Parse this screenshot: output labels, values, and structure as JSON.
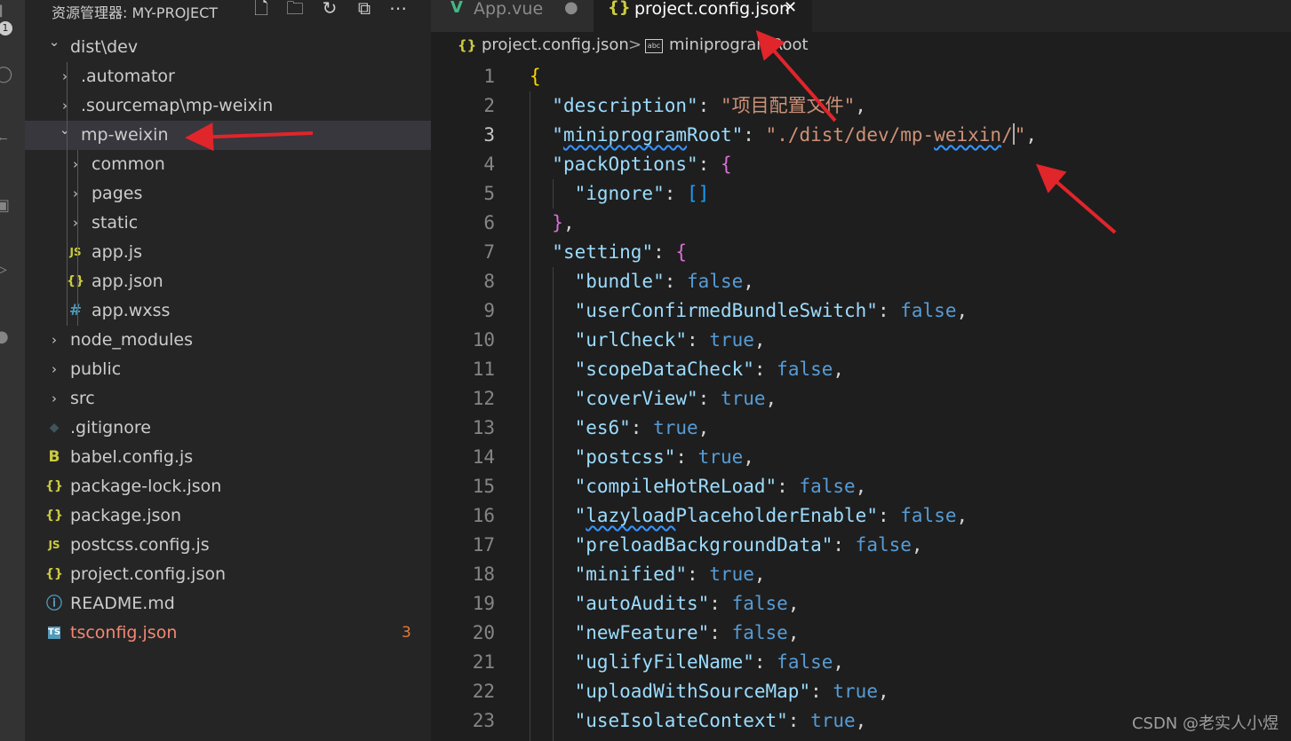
{
  "activity_bar": {
    "scm_badge": "1",
    "icons": [
      "explorer-icon",
      "search-icon",
      "source-control-icon",
      "extensions-icon",
      "run-icon",
      "account-icon"
    ]
  },
  "sidebar": {
    "title": "资源管理器: MY-PROJECT",
    "actions": [
      "new-file-icon",
      "new-folder-icon",
      "refresh-icon",
      "collapse-all-icon",
      "more-icon"
    ],
    "tree": [
      {
        "label": "dist\\dev",
        "type": "folder",
        "expanded": true,
        "depth": 0
      },
      {
        "label": ".automator",
        "type": "folder",
        "expanded": false,
        "depth": 1
      },
      {
        "label": ".sourcemap\\mp-weixin",
        "type": "folder",
        "expanded": false,
        "depth": 1
      },
      {
        "label": "mp-weixin",
        "type": "folder",
        "expanded": true,
        "depth": 1,
        "selected": true
      },
      {
        "label": "common",
        "type": "folder",
        "expanded": false,
        "depth": 2
      },
      {
        "label": "pages",
        "type": "folder",
        "expanded": false,
        "depth": 2
      },
      {
        "label": "static",
        "type": "folder",
        "expanded": false,
        "depth": 2
      },
      {
        "label": "app.js",
        "type": "js",
        "depth": 2
      },
      {
        "label": "app.json",
        "type": "json",
        "depth": 2
      },
      {
        "label": "app.wxss",
        "type": "css",
        "depth": 2
      },
      {
        "label": "node_modules",
        "type": "folder",
        "expanded": false,
        "depth": 0
      },
      {
        "label": "public",
        "type": "folder",
        "expanded": false,
        "depth": 0
      },
      {
        "label": "src",
        "type": "folder",
        "expanded": false,
        "depth": 0
      },
      {
        "label": ".gitignore",
        "type": "git",
        "depth": 0
      },
      {
        "label": "babel.config.js",
        "type": "babel",
        "depth": 0
      },
      {
        "label": "package-lock.json",
        "type": "json",
        "depth": 0
      },
      {
        "label": "package.json",
        "type": "json",
        "depth": 0
      },
      {
        "label": "postcss.config.js",
        "type": "js",
        "depth": 0
      },
      {
        "label": "project.config.json",
        "type": "json",
        "depth": 0
      },
      {
        "label": "README.md",
        "type": "info",
        "depth": 0
      },
      {
        "label": "tsconfig.json",
        "type": "ts",
        "depth": 0,
        "error_count": "3"
      }
    ]
  },
  "tabs": [
    {
      "label": "App.vue",
      "active": false,
      "modified": true
    },
    {
      "label": "project.config.json",
      "active": true,
      "modified": false
    }
  ],
  "breadcrumb": {
    "file": "project.config.json",
    "separator": ">",
    "symbol": "miniprogramRoot"
  },
  "editor": {
    "current_line": 3,
    "lines": [
      {
        "n": "1",
        "html": "<span class=\"y\">{</span>"
      },
      {
        "n": "2",
        "html": "  <span class=\"k\">\"description\"</span><span class=\"p\">: </span><span class=\"s\">\"项目配置文件\"</span><span class=\"p\">,</span>"
      },
      {
        "n": "3",
        "html": "  <span class=\"k\">\"<span class=\"squig\">miniprogram</span>Root\"</span><span class=\"p\">: </span><span class=\"s\">\"./dist/dev/mp-<span class=\"squig\">weixin</span>/<span class=\"cursor\"></span>\"</span><span class=\"p\">,</span>"
      },
      {
        "n": "4",
        "html": "  <span class=\"k\">\"packOptions\"</span><span class=\"p\">: </span><span class=\"m\">{</span>"
      },
      {
        "n": "5",
        "html": "    <span class=\"k\">\"ignore\"</span><span class=\"p\">: </span><span class=\"bl\">[]</span>"
      },
      {
        "n": "6",
        "html": "  <span class=\"m\">}</span><span class=\"p\">,</span>"
      },
      {
        "n": "7",
        "html": "  <span class=\"k\">\"setting\"</span><span class=\"p\">: </span><span class=\"m\">{</span>"
      },
      {
        "n": "8",
        "html": "    <span class=\"k\">\"bundle\"</span><span class=\"p\">: </span><span class=\"b\">false</span><span class=\"p\">,</span>"
      },
      {
        "n": "9",
        "html": "    <span class=\"k\">\"userConfirmedBundleSwitch\"</span><span class=\"p\">: </span><span class=\"b\">false</span><span class=\"p\">,</span>"
      },
      {
        "n": "10",
        "html": "    <span class=\"k\">\"urlCheck\"</span><span class=\"p\">: </span><span class=\"b\">true</span><span class=\"p\">,</span>"
      },
      {
        "n": "11",
        "html": "    <span class=\"k\">\"scopeDataCheck\"</span><span class=\"p\">: </span><span class=\"b\">false</span><span class=\"p\">,</span>"
      },
      {
        "n": "12",
        "html": "    <span class=\"k\">\"coverView\"</span><span class=\"p\">: </span><span class=\"b\">true</span><span class=\"p\">,</span>"
      },
      {
        "n": "13",
        "html": "    <span class=\"k\">\"es6\"</span><span class=\"p\">: </span><span class=\"b\">true</span><span class=\"p\">,</span>"
      },
      {
        "n": "14",
        "html": "    <span class=\"k\">\"postcss\"</span><span class=\"p\">: </span><span class=\"b\">true</span><span class=\"p\">,</span>"
      },
      {
        "n": "15",
        "html": "    <span class=\"k\">\"compileHotReLoad\"</span><span class=\"p\">: </span><span class=\"b\">false</span><span class=\"p\">,</span>"
      },
      {
        "n": "16",
        "html": "    <span class=\"k\">\"<span class=\"squig\">lazyload</span>PlaceholderEnable\"</span><span class=\"p\">: </span><span class=\"b\">false</span><span class=\"p\">,</span>"
      },
      {
        "n": "17",
        "html": "    <span class=\"k\">\"preloadBackgroundData\"</span><span class=\"p\">: </span><span class=\"b\">false</span><span class=\"p\">,</span>"
      },
      {
        "n": "18",
        "html": "    <span class=\"k\">\"minified\"</span><span class=\"p\">: </span><span class=\"b\">true</span><span class=\"p\">,</span>"
      },
      {
        "n": "19",
        "html": "    <span class=\"k\">\"autoAudits\"</span><span class=\"p\">: </span><span class=\"b\">false</span><span class=\"p\">,</span>"
      },
      {
        "n": "20",
        "html": "    <span class=\"k\">\"newFeature\"</span><span class=\"p\">: </span><span class=\"b\">false</span><span class=\"p\">,</span>"
      },
      {
        "n": "21",
        "html": "    <span class=\"k\">\"uglifyFileName\"</span><span class=\"p\">: </span><span class=\"b\">false</span><span class=\"p\">,</span>"
      },
      {
        "n": "22",
        "html": "    <span class=\"k\">\"uploadWithSourceMap\"</span><span class=\"p\">: </span><span class=\"b\">true</span><span class=\"p\">,</span>"
      },
      {
        "n": "23",
        "html": "    <span class=\"k\">\"useIsolateContext\"</span><span class=\"p\">: </span><span class=\"b\">true</span><span class=\"p\">,</span>"
      }
    ]
  },
  "watermark": "CSDN @老实人小煜",
  "colors": {
    "annotation_arrow": "#e0252b",
    "selected_row": "#37373d",
    "error_text": "#f48771"
  }
}
